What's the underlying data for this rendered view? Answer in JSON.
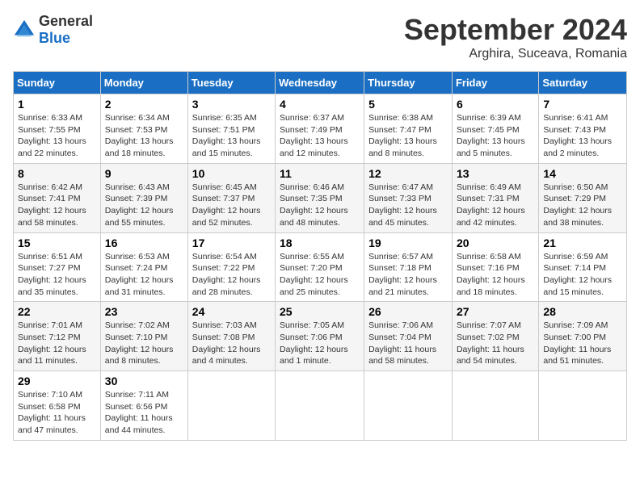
{
  "logo": {
    "general": "General",
    "blue": "Blue"
  },
  "header": {
    "month": "September 2024",
    "location": "Arghira, Suceava, Romania"
  },
  "weekdays": [
    "Sunday",
    "Monday",
    "Tuesday",
    "Wednesday",
    "Thursday",
    "Friday",
    "Saturday"
  ],
  "weeks": [
    [
      {
        "day": "1",
        "sunrise": "6:33 AM",
        "sunset": "7:55 PM",
        "daylight": "13 hours and 22 minutes."
      },
      {
        "day": "2",
        "sunrise": "6:34 AM",
        "sunset": "7:53 PM",
        "daylight": "13 hours and 18 minutes."
      },
      {
        "day": "3",
        "sunrise": "6:35 AM",
        "sunset": "7:51 PM",
        "daylight": "13 hours and 15 minutes."
      },
      {
        "day": "4",
        "sunrise": "6:37 AM",
        "sunset": "7:49 PM",
        "daylight": "13 hours and 12 minutes."
      },
      {
        "day": "5",
        "sunrise": "6:38 AM",
        "sunset": "7:47 PM",
        "daylight": "13 hours and 8 minutes."
      },
      {
        "day": "6",
        "sunrise": "6:39 AM",
        "sunset": "7:45 PM",
        "daylight": "13 hours and 5 minutes."
      },
      {
        "day": "7",
        "sunrise": "6:41 AM",
        "sunset": "7:43 PM",
        "daylight": "13 hours and 2 minutes."
      }
    ],
    [
      {
        "day": "8",
        "sunrise": "6:42 AM",
        "sunset": "7:41 PM",
        "daylight": "12 hours and 58 minutes."
      },
      {
        "day": "9",
        "sunrise": "6:43 AM",
        "sunset": "7:39 PM",
        "daylight": "12 hours and 55 minutes."
      },
      {
        "day": "10",
        "sunrise": "6:45 AM",
        "sunset": "7:37 PM",
        "daylight": "12 hours and 52 minutes."
      },
      {
        "day": "11",
        "sunrise": "6:46 AM",
        "sunset": "7:35 PM",
        "daylight": "12 hours and 48 minutes."
      },
      {
        "day": "12",
        "sunrise": "6:47 AM",
        "sunset": "7:33 PM",
        "daylight": "12 hours and 45 minutes."
      },
      {
        "day": "13",
        "sunrise": "6:49 AM",
        "sunset": "7:31 PM",
        "daylight": "12 hours and 42 minutes."
      },
      {
        "day": "14",
        "sunrise": "6:50 AM",
        "sunset": "7:29 PM",
        "daylight": "12 hours and 38 minutes."
      }
    ],
    [
      {
        "day": "15",
        "sunrise": "6:51 AM",
        "sunset": "7:27 PM",
        "daylight": "12 hours and 35 minutes."
      },
      {
        "day": "16",
        "sunrise": "6:53 AM",
        "sunset": "7:24 PM",
        "daylight": "12 hours and 31 minutes."
      },
      {
        "day": "17",
        "sunrise": "6:54 AM",
        "sunset": "7:22 PM",
        "daylight": "12 hours and 28 minutes."
      },
      {
        "day": "18",
        "sunrise": "6:55 AM",
        "sunset": "7:20 PM",
        "daylight": "12 hours and 25 minutes."
      },
      {
        "day": "19",
        "sunrise": "6:57 AM",
        "sunset": "7:18 PM",
        "daylight": "12 hours and 21 minutes."
      },
      {
        "day": "20",
        "sunrise": "6:58 AM",
        "sunset": "7:16 PM",
        "daylight": "12 hours and 18 minutes."
      },
      {
        "day": "21",
        "sunrise": "6:59 AM",
        "sunset": "7:14 PM",
        "daylight": "12 hours and 15 minutes."
      }
    ],
    [
      {
        "day": "22",
        "sunrise": "7:01 AM",
        "sunset": "7:12 PM",
        "daylight": "12 hours and 11 minutes."
      },
      {
        "day": "23",
        "sunrise": "7:02 AM",
        "sunset": "7:10 PM",
        "daylight": "12 hours and 8 minutes."
      },
      {
        "day": "24",
        "sunrise": "7:03 AM",
        "sunset": "7:08 PM",
        "daylight": "12 hours and 4 minutes."
      },
      {
        "day": "25",
        "sunrise": "7:05 AM",
        "sunset": "7:06 PM",
        "daylight": "12 hours and 1 minute."
      },
      {
        "day": "26",
        "sunrise": "7:06 AM",
        "sunset": "7:04 PM",
        "daylight": "11 hours and 58 minutes."
      },
      {
        "day": "27",
        "sunrise": "7:07 AM",
        "sunset": "7:02 PM",
        "daylight": "11 hours and 54 minutes."
      },
      {
        "day": "28",
        "sunrise": "7:09 AM",
        "sunset": "7:00 PM",
        "daylight": "11 hours and 51 minutes."
      }
    ],
    [
      {
        "day": "29",
        "sunrise": "7:10 AM",
        "sunset": "6:58 PM",
        "daylight": "11 hours and 47 minutes."
      },
      {
        "day": "30",
        "sunrise": "7:11 AM",
        "sunset": "6:56 PM",
        "daylight": "11 hours and 44 minutes."
      },
      null,
      null,
      null,
      null,
      null
    ]
  ]
}
